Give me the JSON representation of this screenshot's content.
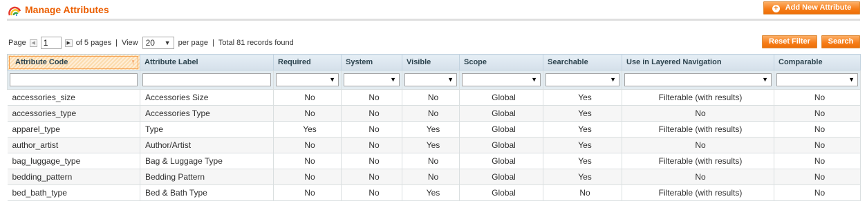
{
  "header": {
    "title": "Manage Attributes",
    "add_button": "Add New Attribute",
    "logo_icon": "rainbow-icon"
  },
  "pager": {
    "page_label": "Page",
    "page_value": "1",
    "of_pages": "of 5 pages",
    "view_label": "View",
    "view_value": "20",
    "per_page": "per page",
    "total": "Total 81 records found"
  },
  "buttons": {
    "reset": "Reset Filter",
    "search": "Search"
  },
  "columns": [
    "Attribute Code",
    "Attribute Label",
    "Required",
    "System",
    "Visible",
    "Scope",
    "Searchable",
    "Use in Layered Navigation",
    "Comparable"
  ],
  "rows": [
    [
      "accessories_size",
      "Accessories Size",
      "No",
      "No",
      "No",
      "Global",
      "Yes",
      "Filterable (with results)",
      "No"
    ],
    [
      "accessories_type",
      "Accessories Type",
      "No",
      "No",
      "No",
      "Global",
      "Yes",
      "No",
      "No"
    ],
    [
      "apparel_type",
      "Type",
      "Yes",
      "No",
      "Yes",
      "Global",
      "Yes",
      "Filterable (with results)",
      "No"
    ],
    [
      "author_artist",
      "Author/Artist",
      "No",
      "No",
      "Yes",
      "Global",
      "Yes",
      "No",
      "No"
    ],
    [
      "bag_luggage_type",
      "Bag & Luggage Type",
      "No",
      "No",
      "No",
      "Global",
      "Yes",
      "Filterable (with results)",
      "No"
    ],
    [
      "bedding_pattern",
      "Bedding Pattern",
      "No",
      "No",
      "No",
      "Global",
      "Yes",
      "No",
      "No"
    ],
    [
      "bed_bath_type",
      "Bed & Bath Type",
      "No",
      "No",
      "Yes",
      "Global",
      "No",
      "Filterable (with results)",
      "No"
    ]
  ]
}
